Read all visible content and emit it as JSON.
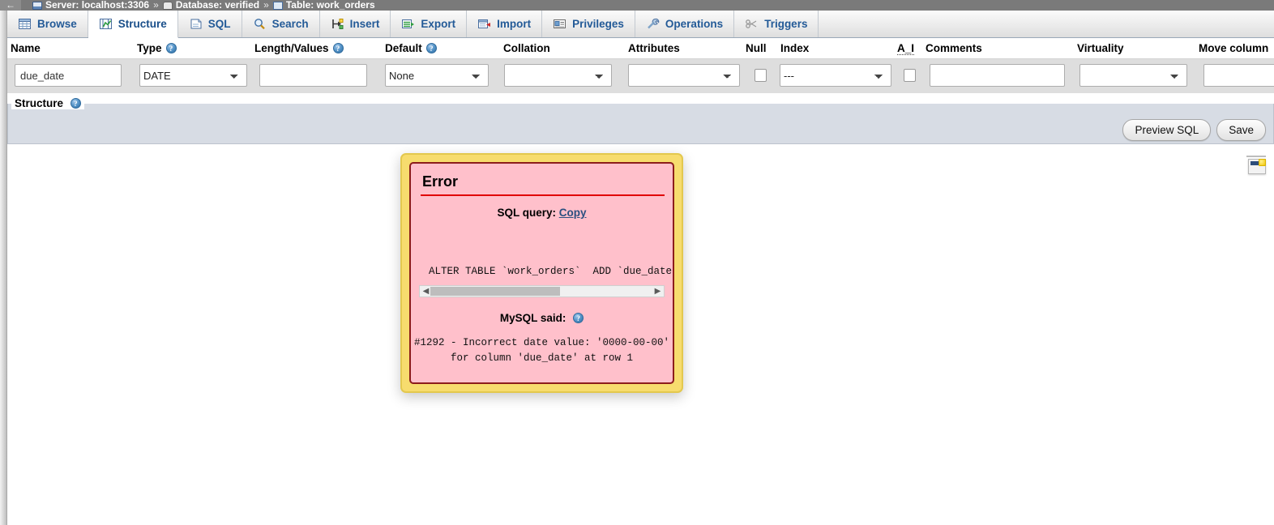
{
  "breadcrumb": {
    "back_label": "←",
    "server": "Server: localhost:3306",
    "database": "Database: verified",
    "table": "Table: work_orders",
    "separator": "»"
  },
  "tabs": [
    {
      "label": "Browse",
      "icon": "browse-icon",
      "active": false
    },
    {
      "label": "Structure",
      "icon": "structure-icon",
      "active": true
    },
    {
      "label": "SQL",
      "icon": "sql-icon",
      "active": false
    },
    {
      "label": "Search",
      "icon": "search-icon",
      "active": false
    },
    {
      "label": "Insert",
      "icon": "insert-icon",
      "active": false
    },
    {
      "label": "Export",
      "icon": "export-icon",
      "active": false
    },
    {
      "label": "Import",
      "icon": "import-icon",
      "active": false
    },
    {
      "label": "Privileges",
      "icon": "privileges-icon",
      "active": false
    },
    {
      "label": "Operations",
      "icon": "operations-icon",
      "active": false
    },
    {
      "label": "Triggers",
      "icon": "triggers-icon",
      "active": false
    }
  ],
  "column_headers": {
    "name": "Name",
    "type": "Type",
    "length_values": "Length/Values",
    "default": "Default",
    "collation": "Collation",
    "attributes": "Attributes",
    "null": "Null",
    "index": "Index",
    "a_i": "A_I",
    "comments": "Comments",
    "virtuality": "Virtuality",
    "move_column": "Move column",
    "help_glyph": "?"
  },
  "field_row": {
    "name_value": "due_date",
    "type_value": "DATE",
    "length_value": "",
    "default_value": "None",
    "collation_value": "",
    "attributes_value": "",
    "null_checked": false,
    "index_value": "---",
    "a_i_checked": false,
    "comments_value": "",
    "virtuality_value": "",
    "move_column_value": ""
  },
  "structure_section": {
    "legend": "Structure",
    "help_glyph": "?"
  },
  "actions": {
    "preview_sql": "Preview SQL",
    "save": "Save"
  },
  "console": {
    "icon": "console-window-icon"
  },
  "error_dialog": {
    "title": "Error",
    "sql_query_label": "SQL query:",
    "copy_link": "Copy",
    "sql_text": "ALTER TABLE `work_orders`  ADD `due_date`",
    "mysql_said_label": "MySQL said:",
    "help_glyph": "?",
    "error_message": "#1292 - Incorrect date value: '0000-00-00'\nfor column 'due_date' at row 1",
    "scroll_left_arrow": "◀",
    "scroll_right_arrow": "▶"
  },
  "colors": {
    "dialog_border": "#f7dc6e",
    "dialog_body": "#ffc0cb",
    "dialog_inner_border": "#8c1c1c",
    "error_rule": "#e00000",
    "tab_text": "#235a97",
    "breadcrumb_bg": "#7a7a7a"
  }
}
